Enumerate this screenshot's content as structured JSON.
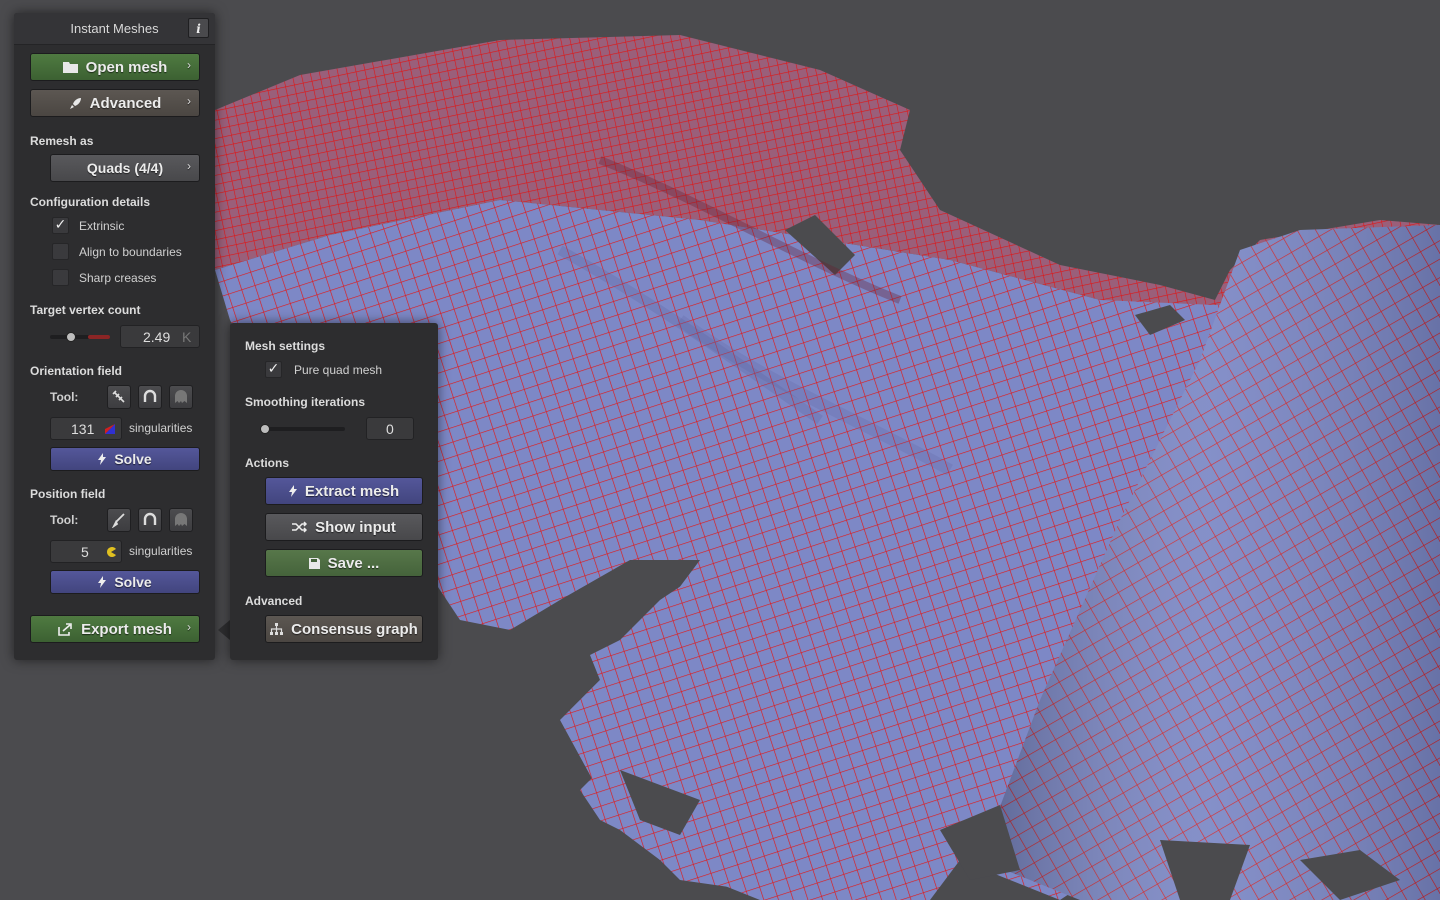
{
  "app": {
    "title": "Instant Meshes",
    "info_label": "i"
  },
  "main": {
    "open_mesh": "Open mesh",
    "advanced": "Advanced",
    "remesh_as_label": "Remesh as",
    "remesh_as_value": "Quads (4/4)",
    "config_label": "Configuration details",
    "options": [
      {
        "label": "Extrinsic",
        "checked": true
      },
      {
        "label": "Align to boundaries",
        "checked": false
      },
      {
        "label": "Sharp creases",
        "checked": false
      }
    ],
    "target_label": "Target vertex count",
    "target_value": "2.49",
    "target_unit": "K",
    "orientation_label": "Orientation field",
    "tool_label": "Tool:",
    "orientation_singularities": "131",
    "singularities_label": "singularities",
    "solve_label": "Solve",
    "position_label": "Position field",
    "position_singularities": "5",
    "export_mesh": "Export mesh",
    "chevron": "›"
  },
  "popup": {
    "mesh_settings_label": "Mesh settings",
    "pure_quad_label": "Pure quad mesh",
    "pure_quad_checked": true,
    "smoothing_label": "Smoothing iterations",
    "smoothing_value": "0",
    "actions_label": "Actions",
    "extract_mesh": "Extract mesh",
    "show_input": "Show input",
    "save": "Save ...",
    "advanced_label": "Advanced",
    "consensus_graph": "Consensus graph"
  },
  "colors": {
    "mesh_fill": "#7b86c8",
    "mesh_edge": "#e02020",
    "background": "#4b4b4e"
  }
}
